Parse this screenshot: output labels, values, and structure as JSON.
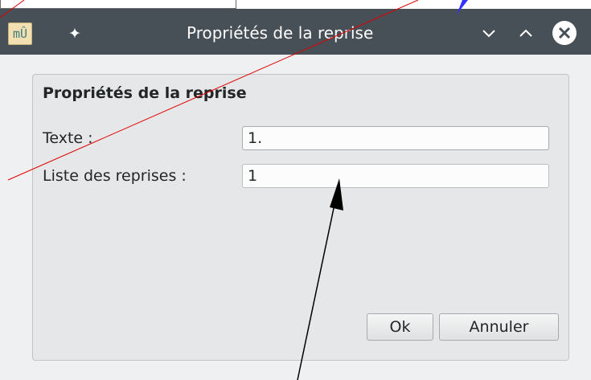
{
  "window": {
    "title": "Propriétés de la reprise",
    "app_icon_glyph": "mÛ",
    "pin_glyph": "✦",
    "minimize_glyph": "⌄",
    "maximize_glyph": "⌃",
    "close_glyph": "✕"
  },
  "group": {
    "title": "Propriétés de la reprise"
  },
  "fields": {
    "texte_label": "Texte :",
    "texte_value": "1.",
    "liste_label": "Liste des reprises :",
    "liste_value": "1"
  },
  "buttons": {
    "ok_label": "Ok",
    "cancel_label": "Annuler"
  },
  "colors": {
    "titlebar": "#475057",
    "window_bg": "#eff0f1",
    "arrow_red": "#e00000",
    "arrow_blue": "#3333ff",
    "arrow_black": "#000000"
  }
}
